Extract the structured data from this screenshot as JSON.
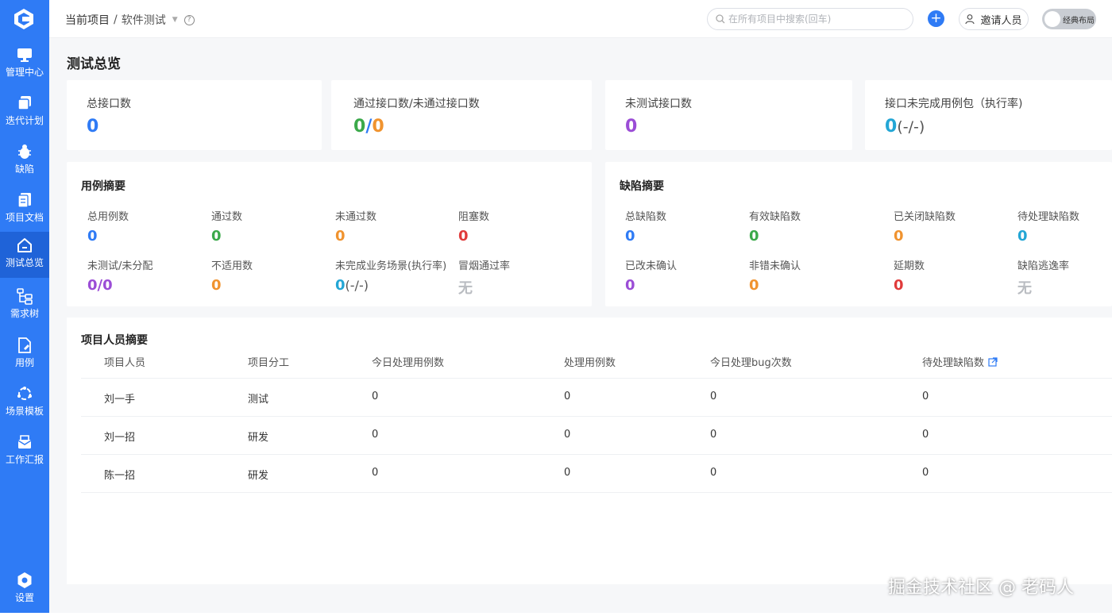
{
  "sidebar": {
    "items": [
      {
        "label": "管理中心",
        "icon": "monitor-icon"
      },
      {
        "label": "迭代计划",
        "icon": "layers-icon"
      },
      {
        "label": "缺陷",
        "icon": "bug-icon"
      },
      {
        "label": "项目文档",
        "icon": "document-icon"
      },
      {
        "label": "测试总览",
        "icon": "home-icon",
        "active": true
      },
      {
        "label": "需求树",
        "icon": "tree-icon"
      },
      {
        "label": "用例",
        "icon": "file-edit-icon"
      },
      {
        "label": "场景模板",
        "icon": "cycle-icon"
      },
      {
        "label": "工作汇报",
        "icon": "report-icon"
      }
    ],
    "settings_label": "设置"
  },
  "header": {
    "breadcrumb_root": "当前项目",
    "breadcrumb_separator": "/",
    "project_name": "软件测试",
    "search_placeholder": "在所有项目中搜索(回车)",
    "invite_label": "邀请人员",
    "layout_toggle_label": "经典布局"
  },
  "page": {
    "title": "测试总览"
  },
  "stats": {
    "total_interfaces": {
      "label": "总接口数",
      "value": "0"
    },
    "pass_fail": {
      "label": "通过接口数/未通过接口数",
      "pass": "0",
      "sep": "/",
      "fail": "0"
    },
    "untested": {
      "label": "未测试接口数",
      "value": "0"
    },
    "incomplete": {
      "label": "接口未完成用例包（执行率)",
      "value": "0",
      "rate": "(-/-)"
    }
  },
  "case_summary": {
    "title": "用例摘要",
    "metrics": [
      {
        "label": "总用例数",
        "value": "0"
      },
      {
        "label": "通过数",
        "value": "0"
      },
      {
        "label": "未通过数",
        "value": "0"
      },
      {
        "label": "阻塞数",
        "value": "0"
      },
      {
        "label": "未测试/未分配",
        "value": "0/0"
      },
      {
        "label": "不适用数",
        "value": "0"
      },
      {
        "label": "未完成业务场景(执行率)",
        "value": "0",
        "rate": "(-/-)"
      },
      {
        "label": "冒烟通过率",
        "value": "无"
      }
    ]
  },
  "defect_summary": {
    "title": "缺陷摘要",
    "metrics": [
      {
        "label": "总缺陷数",
        "value": "0"
      },
      {
        "label": "有效缺陷数",
        "value": "0"
      },
      {
        "label": "已关闭缺陷数",
        "value": "0"
      },
      {
        "label": "待处理缺陷数",
        "value": "0"
      },
      {
        "label": "已改未确认",
        "value": "0"
      },
      {
        "label": "非错未确认",
        "value": "0"
      },
      {
        "label": "延期数",
        "value": "0"
      },
      {
        "label": "缺陷逃逸率",
        "value": "无"
      }
    ]
  },
  "team": {
    "title": "项目人员摘要",
    "columns": [
      "项目人员",
      "项目分工",
      "今日处理用例数",
      "处理用例数",
      "今日处理bug次数",
      "待处理缺陷数"
    ],
    "rows": [
      [
        "刘一手",
        "测试",
        "0",
        "0",
        "0",
        "0"
      ],
      [
        "刘一招",
        "研发",
        "0",
        "0",
        "0",
        "0"
      ],
      [
        "陈一招",
        "研发",
        "0",
        "0",
        "0",
        "0"
      ]
    ]
  },
  "watermark": "掘金技术社区 @ 老码人"
}
